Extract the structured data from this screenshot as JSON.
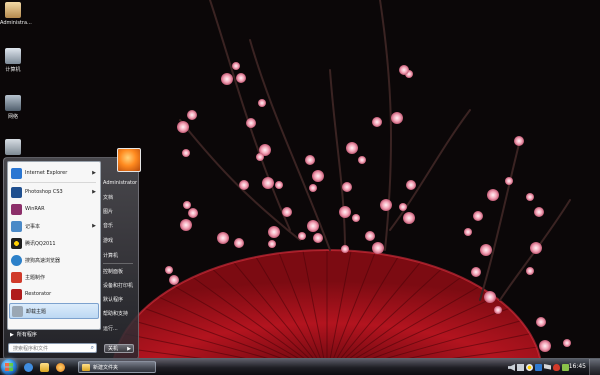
{
  "watermark": "",
  "desktop": {
    "icons": [
      {
        "label": "Administra...",
        "icon": "user-folder-icon",
        "color": "#d9b98a"
      },
      {
        "label": "计算机",
        "icon": "computer-icon",
        "color": "#b9c4cf"
      },
      {
        "label": "网络",
        "icon": "network-icon",
        "color": "#8a98a8"
      },
      {
        "label": "",
        "icon": "recycle-bin-icon",
        "color": "#a7b2bb"
      }
    ]
  },
  "start_menu": {
    "programs": [
      {
        "label": "Internet Explorer",
        "icon": "internet-explorer-icon",
        "color": "#2a76d2",
        "arrow": true
      },
      {
        "label": "Photoshop CS3",
        "icon": "photoshop-icon",
        "color": "#1f4f8f",
        "arrow": true
      },
      {
        "label": "WinRAR",
        "icon": "winrar-icon",
        "color": "#8c2f6a",
        "arrow": false
      },
      {
        "label": "记事本",
        "icon": "notepad-icon",
        "color": "#4a89c7",
        "arrow": true
      },
      {
        "label": "腾讯QQ2011",
        "icon": "qq-icon",
        "color": "#1d1d1d",
        "arrow": false
      },
      {
        "label": "搜狗高速浏览器",
        "icon": "sogou-browser-icon",
        "color": "#2c80c9",
        "arrow": false
      },
      {
        "label": "主题制作",
        "icon": "theme-maker-icon",
        "color": "#d03a2a",
        "arrow": false
      },
      {
        "label": "Restorator",
        "icon": "restorator-icon",
        "color": "#b01c1c",
        "arrow": false
      },
      {
        "label": "卸载主题",
        "icon": "uninstall-theme-icon",
        "color": "#9aa7b4",
        "arrow": false
      }
    ],
    "all_programs": "所有程序",
    "search_placeholder": "搜索程序和文件",
    "right_items": [
      "Administrator",
      "文档",
      "图片",
      "音乐",
      "游戏",
      "计算机",
      "控制面板",
      "设备和打印机",
      "默认程序",
      "帮助和支持",
      "运行..."
    ],
    "shutdown_label": "关机"
  },
  "taskbar": {
    "quick_launch": [
      {
        "icon": "internet-explorer-icon",
        "color": "#3f8de0"
      },
      {
        "icon": "folder-icon",
        "color": "#e4b637"
      },
      {
        "icon": "media-player-icon",
        "color": "#e37b1c"
      }
    ],
    "window_button": "新建文件夹",
    "tray_icons": [
      {
        "icon": "speaker-icon",
        "color": "#c9cfd6"
      },
      {
        "icon": "network-tray-icon",
        "color": "#c9cfd6"
      },
      {
        "icon": "qq-tray-icon",
        "color": "#e6e6e6"
      },
      {
        "icon": "input-method-icon",
        "color": "#2f7ad0"
      },
      {
        "icon": "flag-tray-icon",
        "color": "#d7d7d7"
      },
      {
        "icon": "security-icon",
        "color": "#d13a2a"
      },
      {
        "icon": "battery-icon",
        "color": "#8bc34a"
      }
    ],
    "clock": "16:45"
  },
  "colors": {
    "wallpaper_background": "#0b0708",
    "fan_red": "#b3141f",
    "blossom_pink": "#f4a7b9",
    "branch_brown": "#3a2322"
  }
}
